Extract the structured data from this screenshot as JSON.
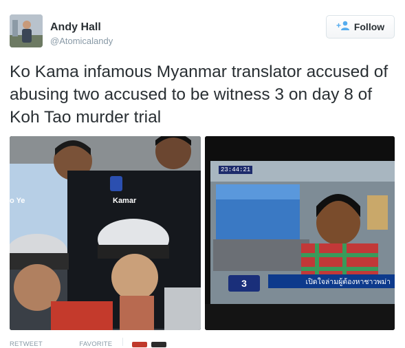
{
  "user": {
    "name": "Andy Hall",
    "handle": "@Atomicalandy"
  },
  "follow": {
    "label": "Follow",
    "icon": "add-user-icon"
  },
  "tweet": {
    "text": "Ko Kama infamous Myanmar translator accused of abusing two accused to be witness 3 on day 8 of Koh Tao murder trial"
  },
  "photos": [
    {
      "captions": [
        "o Ye",
        "Kamar"
      ]
    },
    {
      "timestamp": "23:44:21",
      "channel": "3",
      "ticker": "เปิดใจล่ามผู้ต้องหาชาวพม่า"
    }
  ],
  "stats": {
    "retweets_label": "RETWEET",
    "favorites_label": "FAVORITE"
  },
  "colors": {
    "accent": "#55acee",
    "text": "#292f33",
    "muted": "#8899a6"
  }
}
